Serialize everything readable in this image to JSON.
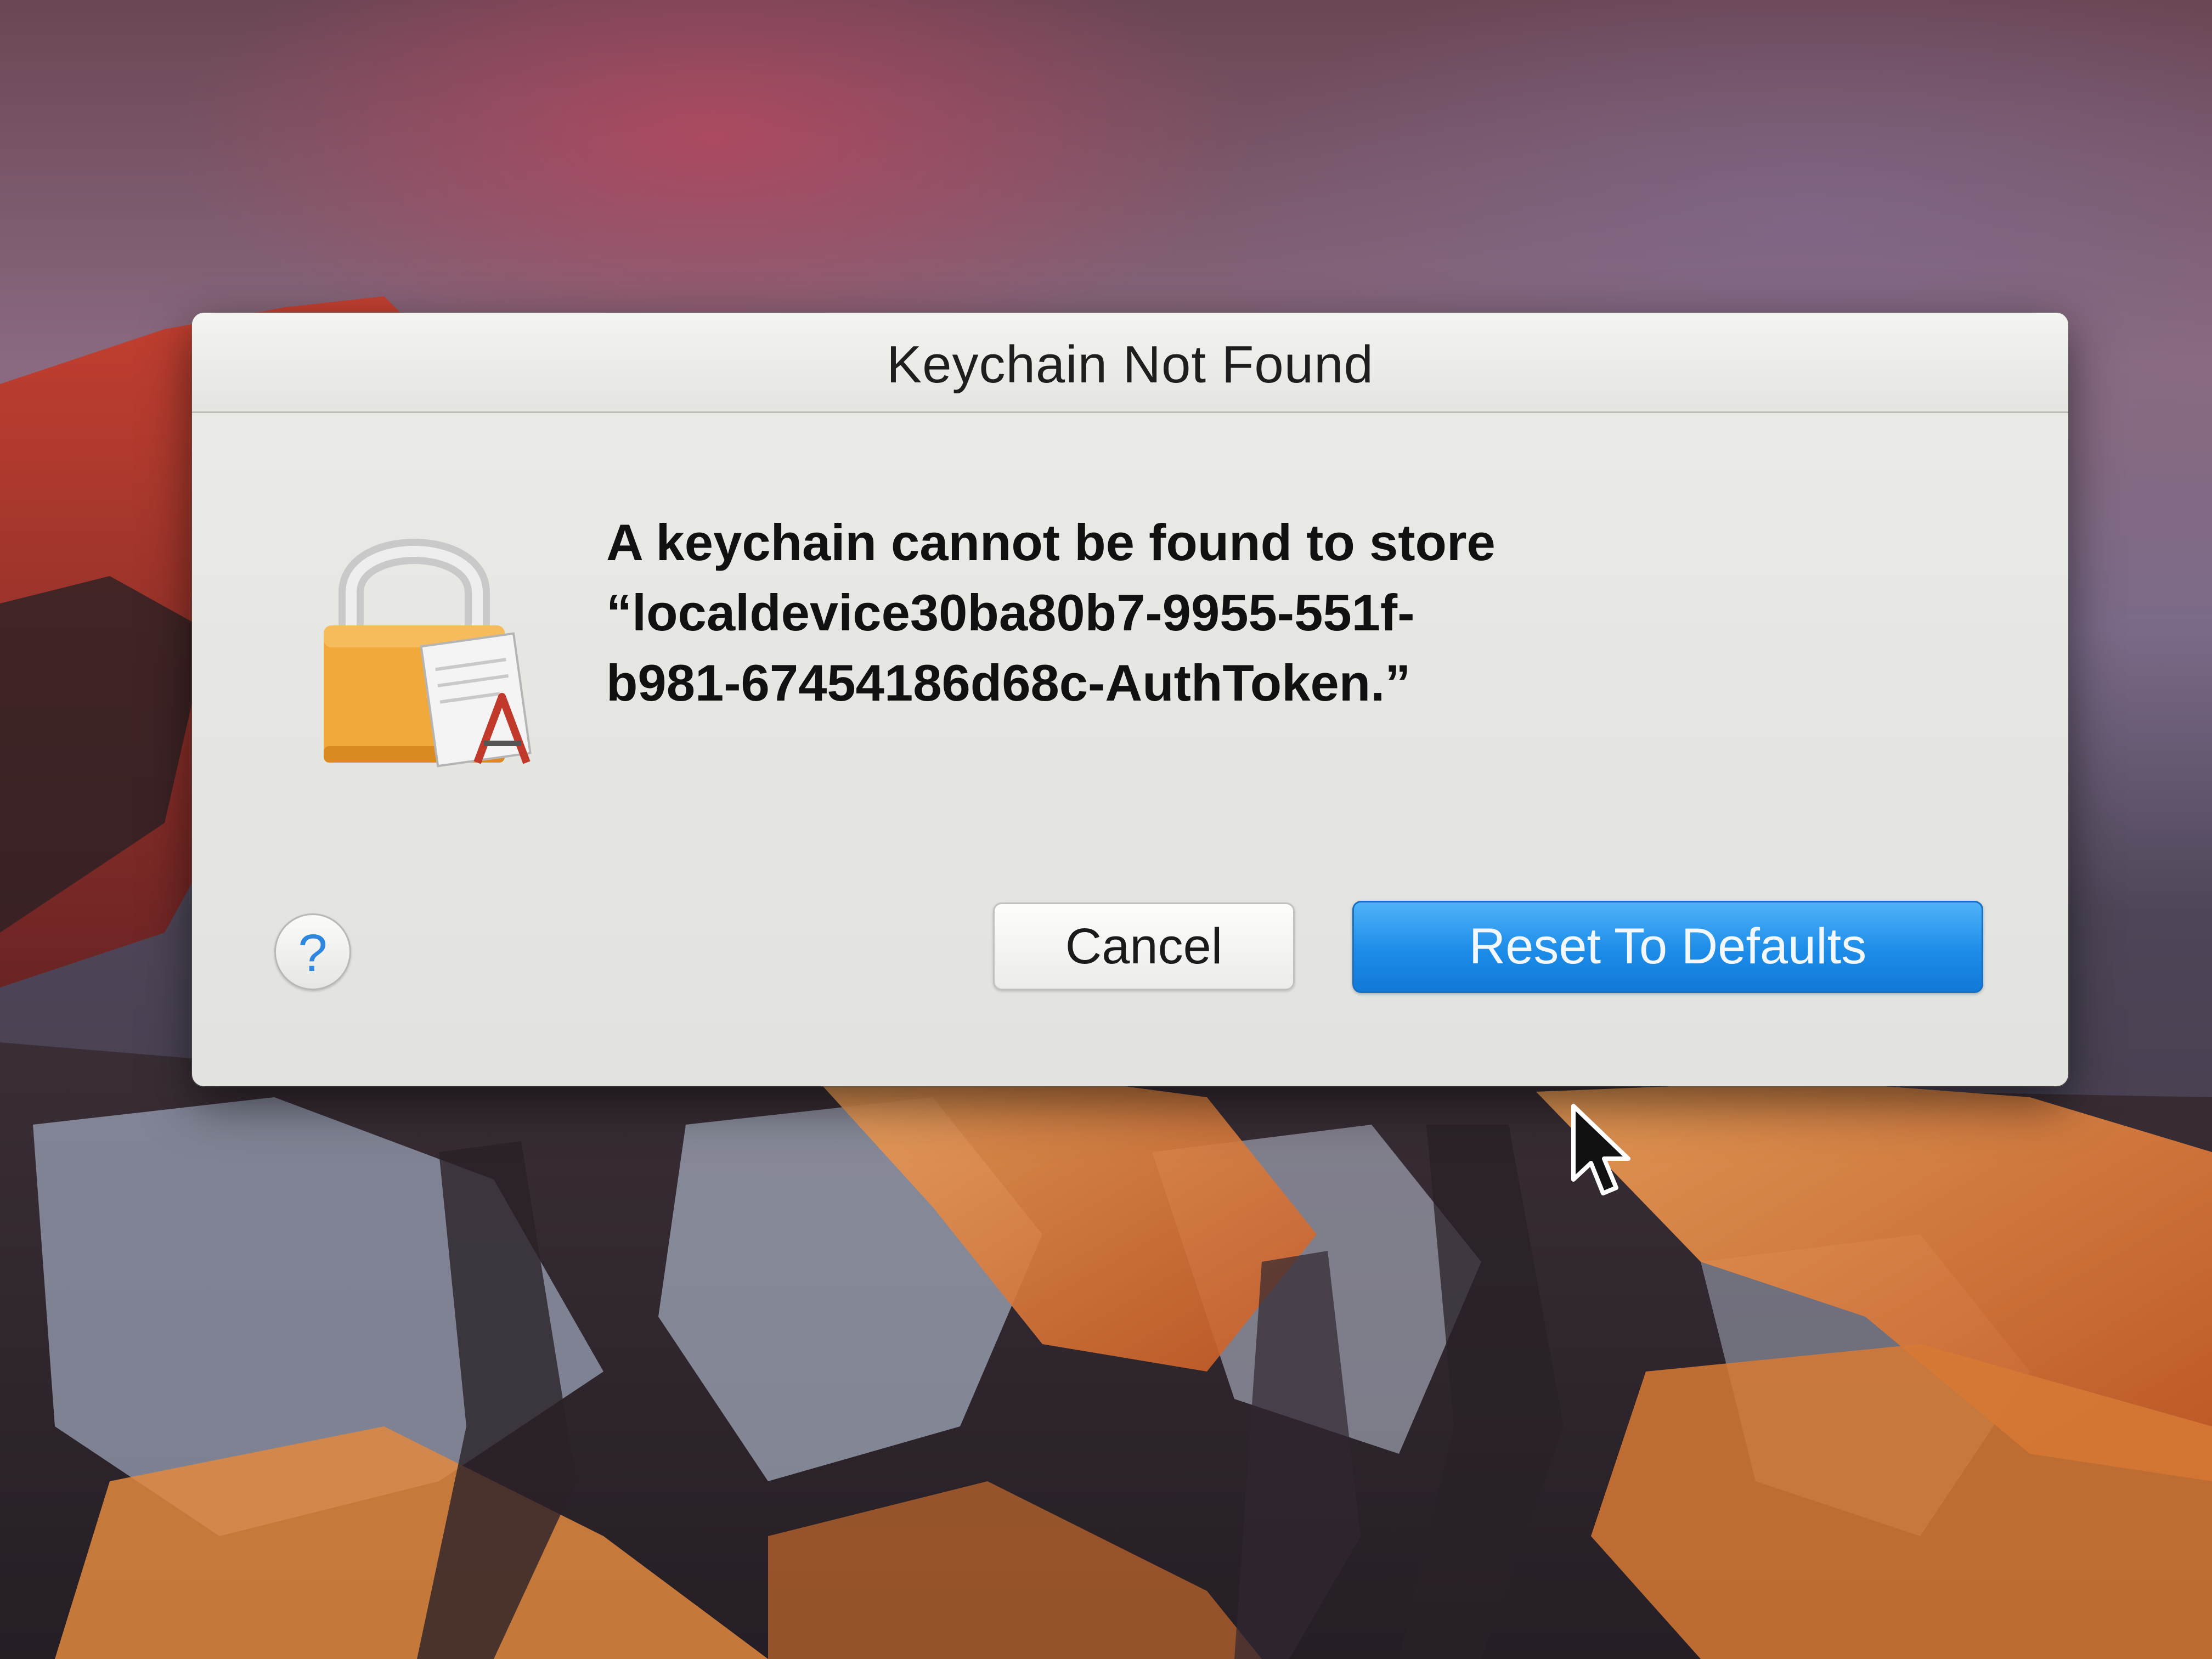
{
  "dialog": {
    "title": "Keychain Not Found",
    "message_lines": [
      "A keychain cannot be found to store",
      "“localdevice30ba80b7-9955-551f-",
      "b981-67454186d68c-AuthToken.”"
    ],
    "icon": "keychain-lock-icon",
    "help_label": "?",
    "cancel_label": "Cancel",
    "default_label": "Reset To Defaults"
  },
  "colors": {
    "default_button": "#1c8ce8",
    "help_glyph": "#2f86e0",
    "lock_body": "#f2a93b"
  },
  "background": {
    "wallpaper": "mountain-sunset",
    "cursor_icon": "arrow-cursor-icon"
  }
}
